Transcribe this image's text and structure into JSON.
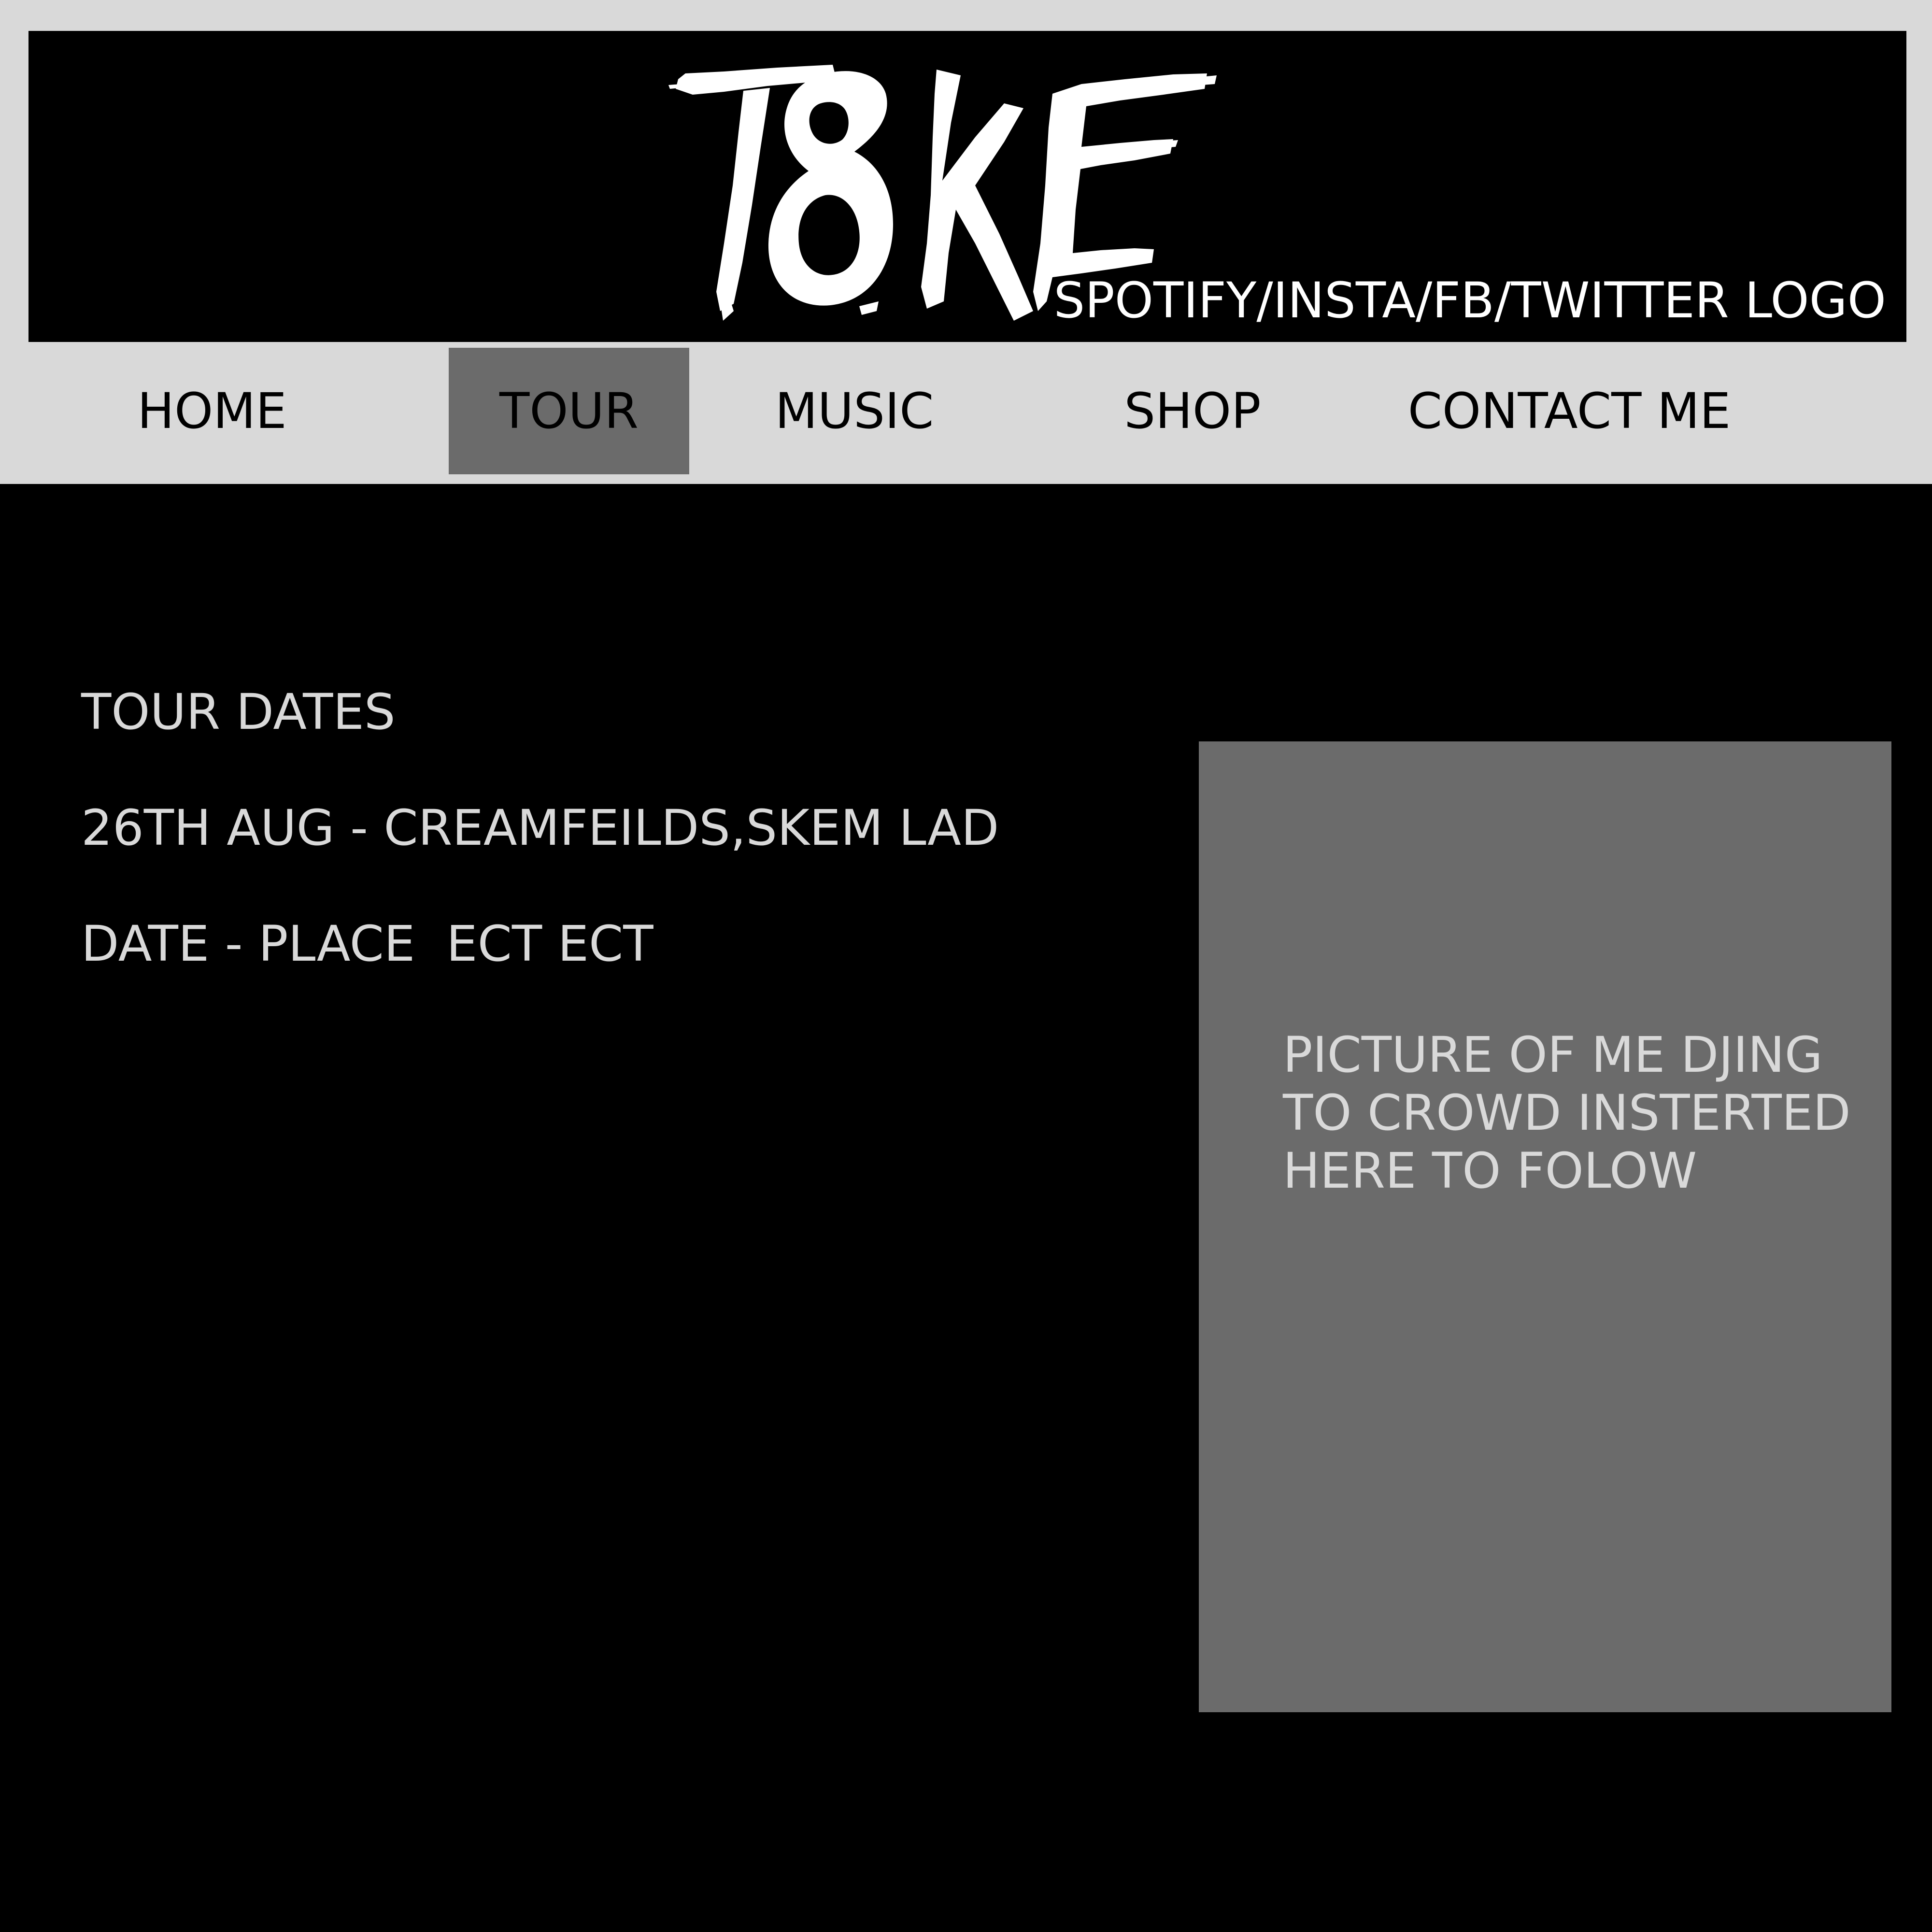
{
  "header": {
    "logo_text": "T8KE",
    "social_text": "SPOTIFY/INSTA/FB/TWITTER LOGO"
  },
  "nav": {
    "items": [
      {
        "label": "HOME"
      },
      {
        "label": "TOUR"
      },
      {
        "label": "MUSIC"
      },
      {
        "label": "SHOP"
      },
      {
        "label": "CONTACT ME"
      }
    ],
    "active": "TOUR"
  },
  "main": {
    "heading": "TOUR DATES",
    "dates": [
      "26TH AUG - CREAMFEILDS,SKEM LAD",
      "DATE - PLACE  ECT ECT"
    ]
  },
  "picture": {
    "lines": [
      "PICTURE OF ME DJING",
      "TO CROWD INSTERTED",
      "HERE TO FOLOW"
    ]
  },
  "colors": {
    "background": "#000000",
    "nav_bar": "#d9d9d9",
    "active_tab": "#6b6b6b",
    "text_light": "#d9d9d9"
  }
}
